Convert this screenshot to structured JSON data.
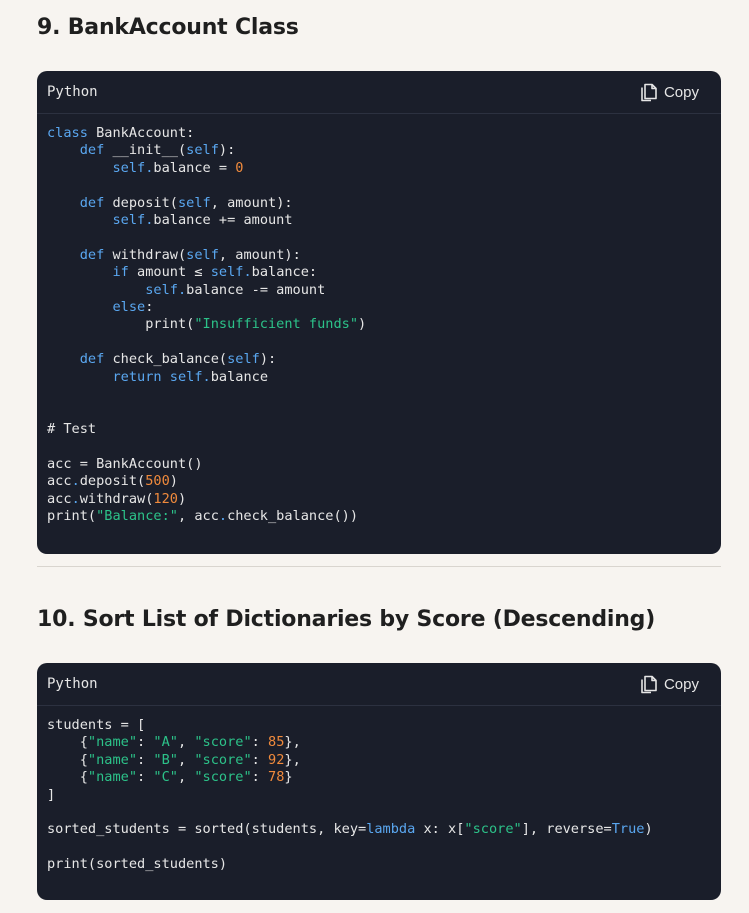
{
  "sections": [
    {
      "title": "9. BankAccount Class",
      "language": "Python",
      "copy_label": "Copy",
      "lines": [
        [
          [
            "class",
            "kw"
          ],
          [
            " BankAccount:",
            ""
          ]
        ],
        [
          [
            "    ",
            ""
          ],
          [
            "def",
            "kw"
          ],
          [
            " __init__(",
            ""
          ],
          [
            "self",
            "kw"
          ],
          [
            "):",
            ""
          ]
        ],
        [
          [
            "        ",
            ""
          ],
          [
            "self",
            "kw"
          ],
          [
            ".",
            "dot"
          ],
          [
            "balance = ",
            ""
          ],
          [
            "0",
            "num"
          ]
        ],
        [],
        [
          [
            "    ",
            ""
          ],
          [
            "def",
            "kw"
          ],
          [
            " deposit(",
            ""
          ],
          [
            "self",
            "kw"
          ],
          [
            ", amount):",
            ""
          ]
        ],
        [
          [
            "        ",
            ""
          ],
          [
            "self",
            "kw"
          ],
          [
            ".",
            "dot"
          ],
          [
            "balance += amount",
            ""
          ]
        ],
        [],
        [
          [
            "    ",
            ""
          ],
          [
            "def",
            "kw"
          ],
          [
            " withdraw(",
            ""
          ],
          [
            "self",
            "kw"
          ],
          [
            ", amount):",
            ""
          ]
        ],
        [
          [
            "        ",
            ""
          ],
          [
            "if",
            "kw"
          ],
          [
            " amount ≤ ",
            ""
          ],
          [
            "self",
            "kw"
          ],
          [
            ".",
            "dot"
          ],
          [
            "balance:",
            ""
          ]
        ],
        [
          [
            "            ",
            ""
          ],
          [
            "self",
            "kw"
          ],
          [
            ".",
            "dot"
          ],
          [
            "balance -= amount",
            ""
          ]
        ],
        [
          [
            "        ",
            ""
          ],
          [
            "else",
            "kw"
          ],
          [
            ":",
            ""
          ]
        ],
        [
          [
            "            print(",
            ""
          ],
          [
            "\"Insufficient funds\"",
            "str"
          ],
          [
            ")",
            ""
          ]
        ],
        [],
        [
          [
            "    ",
            ""
          ],
          [
            "def",
            "kw"
          ],
          [
            " check_balance(",
            ""
          ],
          [
            "self",
            "kw"
          ],
          [
            "):",
            ""
          ]
        ],
        [
          [
            "        ",
            ""
          ],
          [
            "return",
            "kw"
          ],
          [
            " ",
            ""
          ],
          [
            "self",
            "kw"
          ],
          [
            ".",
            "dot"
          ],
          [
            "balance",
            ""
          ]
        ],
        [],
        [],
        [
          [
            "# Test",
            ""
          ]
        ],
        [],
        [
          [
            "acc = BankAccount()",
            ""
          ]
        ],
        [
          [
            "acc",
            ""
          ],
          [
            ".",
            "dot"
          ],
          [
            "deposit(",
            ""
          ],
          [
            "500",
            "num"
          ],
          [
            ")",
            ""
          ]
        ],
        [
          [
            "acc",
            ""
          ],
          [
            ".",
            "dot"
          ],
          [
            "withdraw(",
            ""
          ],
          [
            "120",
            "num"
          ],
          [
            ")",
            ""
          ]
        ],
        [
          [
            "print(",
            ""
          ],
          [
            "\"Balance:\"",
            "str"
          ],
          [
            ", acc",
            ""
          ],
          [
            ".",
            "dot"
          ],
          [
            "check_balance())",
            ""
          ]
        ]
      ]
    },
    {
      "title": "10. Sort List of Dictionaries by Score (Descending)",
      "language": "Python",
      "copy_label": "Copy",
      "lines": [
        [
          [
            "students = [",
            ""
          ]
        ],
        [
          [
            "    {",
            ""
          ],
          [
            "\"name\"",
            "str"
          ],
          [
            ": ",
            ""
          ],
          [
            "\"A\"",
            "str"
          ],
          [
            ", ",
            ""
          ],
          [
            "\"score\"",
            "str"
          ],
          [
            ": ",
            ""
          ],
          [
            "85",
            "num"
          ],
          [
            "},",
            ""
          ]
        ],
        [
          [
            "    {",
            ""
          ],
          [
            "\"name\"",
            "str"
          ],
          [
            ": ",
            ""
          ],
          [
            "\"B\"",
            "str"
          ],
          [
            ", ",
            ""
          ],
          [
            "\"score\"",
            "str"
          ],
          [
            ": ",
            ""
          ],
          [
            "92",
            "num"
          ],
          [
            "},",
            ""
          ]
        ],
        [
          [
            "    {",
            ""
          ],
          [
            "\"name\"",
            "str"
          ],
          [
            ": ",
            ""
          ],
          [
            "\"C\"",
            "str"
          ],
          [
            ", ",
            ""
          ],
          [
            "\"score\"",
            "str"
          ],
          [
            ": ",
            ""
          ],
          [
            "78",
            "num"
          ],
          [
            "}",
            ""
          ]
        ],
        [
          [
            "]",
            ""
          ]
        ],
        [],
        [
          [
            "sorted_students = sorted(students, key=",
            ""
          ],
          [
            "lambda",
            "kw"
          ],
          [
            " x: x[",
            ""
          ],
          [
            "\"score\"",
            "str"
          ],
          [
            "], reverse=",
            ""
          ],
          [
            "True",
            "kw"
          ],
          [
            ")",
            ""
          ]
        ],
        [],
        [
          [
            "print(sorted_students)",
            ""
          ]
        ]
      ]
    }
  ],
  "colors": {
    "keyword": "#5aa7f0",
    "string": "#2cc289",
    "number": "#f08a3c",
    "code_background": "#1a1e2a",
    "page_background": "#f7f4f0"
  },
  "icons": {
    "copy": "copy-icon"
  }
}
